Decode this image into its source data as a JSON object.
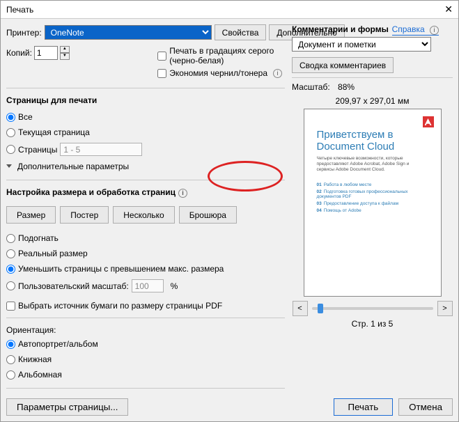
{
  "window": {
    "title": "Печать"
  },
  "top": {
    "printer_label": "Принтер:",
    "printer_value": "OneNote",
    "properties_btn": "Свойства",
    "advanced_btn": "Дополнительно",
    "help_link": "Справка",
    "copies_label": "Копий:",
    "copies_value": "1",
    "grayscale_label": "Печать в градациях серого (черно-белая)",
    "ink_saver_label": "Экономия чернил/тонера"
  },
  "pages": {
    "section": "Страницы для печати",
    "all": "Все",
    "current": "Текущая страница",
    "range": "Страницы",
    "range_ph": "1 - 5",
    "more": "Дополнительные параметры"
  },
  "sizing": {
    "section": "Настройка размера и обработка страниц",
    "tab_size": "Размер",
    "tab_poster": "Постер",
    "tab_multi": "Несколько",
    "tab_booklet": "Брошюра",
    "fit": "Подогнать",
    "actual": "Реальный размер",
    "shrink": "Уменьшить страницы с превышением макс. размера",
    "custom": "Пользовательский масштаб:",
    "custom_val": "100",
    "percent": "%",
    "paper_src": "Выбрать источник бумаги по размеру страницы PDF"
  },
  "orient": {
    "section": "Ориентация:",
    "auto": "Автопортрет/альбом",
    "portrait": "Книжная",
    "landscape": "Альбомная"
  },
  "right": {
    "comments_section": "Комментарии и формы",
    "comments_value": "Документ и пометки",
    "summary_btn": "Сводка комментариев",
    "scale_label": "Масштаб:",
    "scale_value": "88%",
    "dimensions": "209,97 x 297,01 мм",
    "doc_h1_l1": "Приветствуем в",
    "doc_h1_l2": "Document Cloud",
    "doc_sub": "Четыре ключевые возможности, которые предоставляют Adobe Acrobat, Adobe Sign и сервисы Adobe Document Cloud.",
    "li1": "Работа в любом месте",
    "li2": "Подготовка готовых профессиональных документов PDF",
    "li3": "Предоставление доступа к файлам",
    "li4": "Помощь от Adobe",
    "pager": "Стр. 1 из 5"
  },
  "footer": {
    "page_setup": "Параметры страницы...",
    "print": "Печать",
    "cancel": "Отмена"
  }
}
